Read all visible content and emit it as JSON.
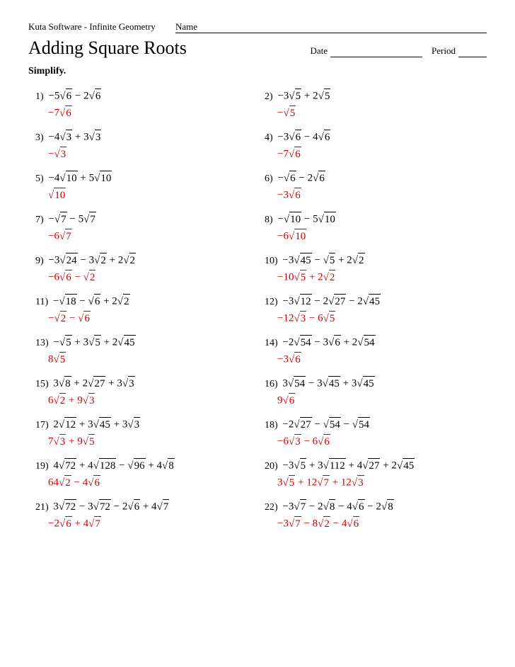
{
  "header": {
    "software": "Kuta Software - Infinite Geometry",
    "name_label": "Name",
    "date_label": "Date",
    "period_label": "Period"
  },
  "title": "Adding Square Roots",
  "simplify_label": "Simplify.",
  "problems": [
    {
      "num": "1)",
      "question": "−5√6 − 2√6",
      "answer": "−7√6",
      "q_html": "−5<span class='rad'><span class='rad-check'>√</span><span class='rad-inner'>6</span></span> − 2<span class='rad'><span class='rad-check'>√</span><span class='rad-inner'>6</span></span>",
      "a_html": "−7<span class='rad'><span class='rad-check'>√</span><span class='rad-inner'>6</span></span>"
    },
    {
      "num": "2)",
      "question": "−3√5 + 2√5",
      "answer": "−√5",
      "q_html": "−3<span class='rad'><span class='rad-check'>√</span><span class='rad-inner'>5</span></span> + 2<span class='rad'><span class='rad-check'>√</span><span class='rad-inner'>5</span></span>",
      "a_html": "−<span class='rad'><span class='rad-check'>√</span><span class='rad-inner'>5</span></span>"
    },
    {
      "num": "3)",
      "question": "−4√3 + 3√3",
      "answer": "−√3",
      "q_html": "−4<span class='rad'><span class='rad-check'>√</span><span class='rad-inner'>3</span></span> + 3<span class='rad'><span class='rad-check'>√</span><span class='rad-inner'>3</span></span>",
      "a_html": "−<span class='rad'><span class='rad-check'>√</span><span class='rad-inner'>3</span></span>"
    },
    {
      "num": "4)",
      "question": "−3√6 − 4√6",
      "answer": "−7√6",
      "q_html": "−3<span class='rad'><span class='rad-check'>√</span><span class='rad-inner'>6</span></span> − 4<span class='rad'><span class='rad-check'>√</span><span class='rad-inner'>6</span></span>",
      "a_html": "−7<span class='rad'><span class='rad-check'>√</span><span class='rad-inner'>6</span></span>"
    },
    {
      "num": "5)",
      "question": "−4√10 + 5√10",
      "answer": "√10",
      "q_html": "−4<span class='rad'><span class='rad-check'>√</span><span class='rad-inner'>10</span></span> + 5<span class='rad'><span class='rad-check'>√</span><span class='rad-inner'>10</span></span>",
      "a_html": "<span class='rad'><span class='rad-check'>√</span><span class='rad-inner'>10</span></span>"
    },
    {
      "num": "6)",
      "question": "−√6 − 2√6",
      "answer": "−3√6",
      "q_html": "−<span class='rad'><span class='rad-check'>√</span><span class='rad-inner'>6</span></span> − 2<span class='rad'><span class='rad-check'>√</span><span class='rad-inner'>6</span></span>",
      "a_html": "−3<span class='rad'><span class='rad-check'>√</span><span class='rad-inner'>6</span></span>"
    },
    {
      "num": "7)",
      "question": "−√7 − 5√7",
      "answer": "−6√7",
      "q_html": "−<span class='rad'><span class='rad-check'>√</span><span class='rad-inner'>7</span></span> − 5<span class='rad'><span class='rad-check'>√</span><span class='rad-inner'>7</span></span>",
      "a_html": "−6<span class='rad'><span class='rad-check'>√</span><span class='rad-inner'>7</span></span>"
    },
    {
      "num": "8)",
      "question": "−√10 − 5√10",
      "answer": "−6√10",
      "q_html": "−<span class='rad'><span class='rad-check'>√</span><span class='rad-inner'>10</span></span> − 5<span class='rad'><span class='rad-check'>√</span><span class='rad-inner'>10</span></span>",
      "a_html": "−6<span class='rad'><span class='rad-check'>√</span><span class='rad-inner'>10</span></span>"
    },
    {
      "num": "9)",
      "question": "−3√24 − 3√2 + 2√2",
      "answer": "−6√6 − √2",
      "q_html": "−3<span class='rad'><span class='rad-check'>√</span><span class='rad-inner'>24</span></span> − 3<span class='rad'><span class='rad-check'>√</span><span class='rad-inner'>2</span></span> + 2<span class='rad'><span class='rad-check'>√</span><span class='rad-inner'>2</span></span>",
      "a_html": "−6<span class='rad'><span class='rad-check'>√</span><span class='rad-inner'>6</span></span> − <span class='rad'><span class='rad-check'>√</span><span class='rad-inner'>2</span></span>"
    },
    {
      "num": "10)",
      "question": "−3√45 − √5 + 2√2",
      "answer": "−10√5 + 2√2",
      "q_html": "−3<span class='rad'><span class='rad-check'>√</span><span class='rad-inner'>45</span></span> − <span class='rad'><span class='rad-check'>√</span><span class='rad-inner'>5</span></span> + 2<span class='rad'><span class='rad-check'>√</span><span class='rad-inner'>2</span></span>",
      "a_html": "−10<span class='rad'><span class='rad-check'>√</span><span class='rad-inner'>5</span></span> + 2<span class='rad'><span class='rad-check'>√</span><span class='rad-inner'>2</span></span>"
    },
    {
      "num": "11)",
      "question": "−√18 − √6 + 2√2",
      "answer": "−√2 − √6",
      "q_html": "−<span class='rad'><span class='rad-check'>√</span><span class='rad-inner'>18</span></span> − <span class='rad'><span class='rad-check'>√</span><span class='rad-inner'>6</span></span> + 2<span class='rad'><span class='rad-check'>√</span><span class='rad-inner'>2</span></span>",
      "a_html": "−<span class='rad'><span class='rad-check'>√</span><span class='rad-inner'>2</span></span> − <span class='rad'><span class='rad-check'>√</span><span class='rad-inner'>6</span></span>"
    },
    {
      "num": "12)",
      "question": "−3√12 − 2√27 − 2√45",
      "answer": "−12√3 − 6√5",
      "q_html": "−3<span class='rad'><span class='rad-check'>√</span><span class='rad-inner'>12</span></span> − 2<span class='rad'><span class='rad-check'>√</span><span class='rad-inner'>27</span></span> − 2<span class='rad'><span class='rad-check'>√</span><span class='rad-inner'>45</span></span>",
      "a_html": "−12<span class='rad'><span class='rad-check'>√</span><span class='rad-inner'>3</span></span> − 6<span class='rad'><span class='rad-check'>√</span><span class='rad-inner'>5</span></span>"
    },
    {
      "num": "13)",
      "question": "−√5 + 3√5 + 2√45",
      "answer": "8√5",
      "q_html": "−<span class='rad'><span class='rad-check'>√</span><span class='rad-inner'>5</span></span> + 3<span class='rad'><span class='rad-check'>√</span><span class='rad-inner'>5</span></span> + 2<span class='rad'><span class='rad-check'>√</span><span class='rad-inner'>45</span></span>",
      "a_html": "8<span class='rad'><span class='rad-check'>√</span><span class='rad-inner'>5</span></span>"
    },
    {
      "num": "14)",
      "question": "−2√54 − 3√6 + 2√54",
      "answer": "−3√6",
      "q_html": "−2<span class='rad'><span class='rad-check'>√</span><span class='rad-inner'>54</span></span> − 3<span class='rad'><span class='rad-check'>√</span><span class='rad-inner'>6</span></span> + 2<span class='rad'><span class='rad-check'>√</span><span class='rad-inner'>54</span></span>",
      "a_html": "−3<span class='rad'><span class='rad-check'>√</span><span class='rad-inner'>6</span></span>"
    },
    {
      "num": "15)",
      "question": "3√8 + 2√27 + 3√3",
      "answer": "6√2 + 9√3",
      "q_html": "3<span class='rad'><span class='rad-check'>√</span><span class='rad-inner'>8</span></span> + 2<span class='rad'><span class='rad-check'>√</span><span class='rad-inner'>27</span></span> + 3<span class='rad'><span class='rad-check'>√</span><span class='rad-inner'>3</span></span>",
      "a_html": "6<span class='rad'><span class='rad-check'>√</span><span class='rad-inner'>2</span></span> + 9<span class='rad'><span class='rad-check'>√</span><span class='rad-inner'>3</span></span>"
    },
    {
      "num": "16)",
      "question": "3√54 − 3√45 + 3√45",
      "answer": "9√6",
      "q_html": "3<span class='rad'><span class='rad-check'>√</span><span class='rad-inner'>54</span></span> − 3<span class='rad'><span class='rad-check'>√</span><span class='rad-inner'>45</span></span> + 3<span class='rad'><span class='rad-check'>√</span><span class='rad-inner'>45</span></span>",
      "a_html": "9<span class='rad'><span class='rad-check'>√</span><span class='rad-inner'>6</span></span>"
    },
    {
      "num": "17)",
      "question": "2√12 + 3√45 + 3√3",
      "answer": "7√3 + 9√5",
      "q_html": "2<span class='rad'><span class='rad-check'>√</span><span class='rad-inner'>12</span></span> + 3<span class='rad'><span class='rad-check'>√</span><span class='rad-inner'>45</span></span> + 3<span class='rad'><span class='rad-check'>√</span><span class='rad-inner'>3</span></span>",
      "a_html": "7<span class='rad'><span class='rad-check'>√</span><span class='rad-inner'>3</span></span> + 9<span class='rad'><span class='rad-check'>√</span><span class='rad-inner'>5</span></span>"
    },
    {
      "num": "18)",
      "question": "−2√27 − √54 − √54",
      "answer": "−6√3 − 6√6",
      "q_html": "−2<span class='rad'><span class='rad-check'>√</span><span class='rad-inner'>27</span></span> − <span class='rad'><span class='rad-check'>√</span><span class='rad-inner'>54</span></span> − <span class='rad'><span class='rad-check'>√</span><span class='rad-inner'>54</span></span>",
      "a_html": "−6<span class='rad'><span class='rad-check'>√</span><span class='rad-inner'>3</span></span> − 6<span class='rad'><span class='rad-check'>√</span><span class='rad-inner'>6</span></span>"
    },
    {
      "num": "19)",
      "question": "4√72 + 4√128 − √96 + 4√8",
      "answer": "64√2 − 4√6",
      "q_html": "4<span class='rad'><span class='rad-check'>√</span><span class='rad-inner'>72</span></span> + 4<span class='rad'><span class='rad-check'>√</span><span class='rad-inner'>128</span></span> − <span class='rad'><span class='rad-check'>√</span><span class='rad-inner'>96</span></span> + 4<span class='rad'><span class='rad-check'>√</span><span class='rad-inner'>8</span></span>",
      "a_html": "64<span class='rad'><span class='rad-check'>√</span><span class='rad-inner'>2</span></span> − 4<span class='rad'><span class='rad-check'>√</span><span class='rad-inner'>6</span></span>"
    },
    {
      "num": "20)",
      "question": "−3√5 + 3√112 + 4√27 + 2√45",
      "answer": "3√5 + 12√7 + 12√3",
      "q_html": "−3<span class='rad'><span class='rad-check'>√</span><span class='rad-inner'>5</span></span> + 3<span class='rad'><span class='rad-check'>√</span><span class='rad-inner'>112</span></span> + 4<span class='rad'><span class='rad-check'>√</span><span class='rad-inner'>27</span></span> + 2<span class='rad'><span class='rad-check'>√</span><span class='rad-inner'>45</span></span>",
      "a_html": "3<span class='rad'><span class='rad-check'>√</span><span class='rad-inner'>5</span></span> + 12<span class='rad'><span class='rad-check'>√</span><span class='rad-inner'>7</span></span> + 12<span class='rad'><span class='rad-check'>√</span><span class='rad-inner'>3</span></span>"
    },
    {
      "num": "21)",
      "question": "3√72 − 3√72 − 2√6 + 4√7",
      "answer": "−2√6 + 4√7",
      "q_html": "3<span class='rad'><span class='rad-check'>√</span><span class='rad-inner'>72</span></span> − 3<span class='rad'><span class='rad-check'>√</span><span class='rad-inner'>72</span></span> − 2<span class='rad'><span class='rad-check'>√</span><span class='rad-inner'>6</span></span> + 4<span class='rad'><span class='rad-check'>√</span><span class='rad-inner'>7</span></span>",
      "a_html": "−2<span class='rad'><span class='rad-check'>√</span><span class='rad-inner'>6</span></span> + 4<span class='rad'><span class='rad-check'>√</span><span class='rad-inner'>7</span></span>"
    },
    {
      "num": "22)",
      "question": "−3√7 − 2√8 − 4√6 − 2√8",
      "answer": "−3√7 − 8√2 − 4√6",
      "q_html": "−3<span class='rad'><span class='rad-check'>√</span><span class='rad-inner'>7</span></span> − 2<span class='rad'><span class='rad-check'>√</span><span class='rad-inner'>8</span></span> − 4<span class='rad'><span class='rad-check'>√</span><span class='rad-inner'>6</span></span> − 2<span class='rad'><span class='rad-check'>√</span><span class='rad-inner'>8</span></span>",
      "a_html": "−3<span class='rad'><span class='rad-check'>√</span><span class='rad-inner'>7</span></span> − 8<span class='rad'><span class='rad-check'>√</span><span class='rad-inner'>2</span></span> − 4<span class='rad'><span class='rad-check'>√</span><span class='rad-inner'>6</span></span>"
    }
  ]
}
